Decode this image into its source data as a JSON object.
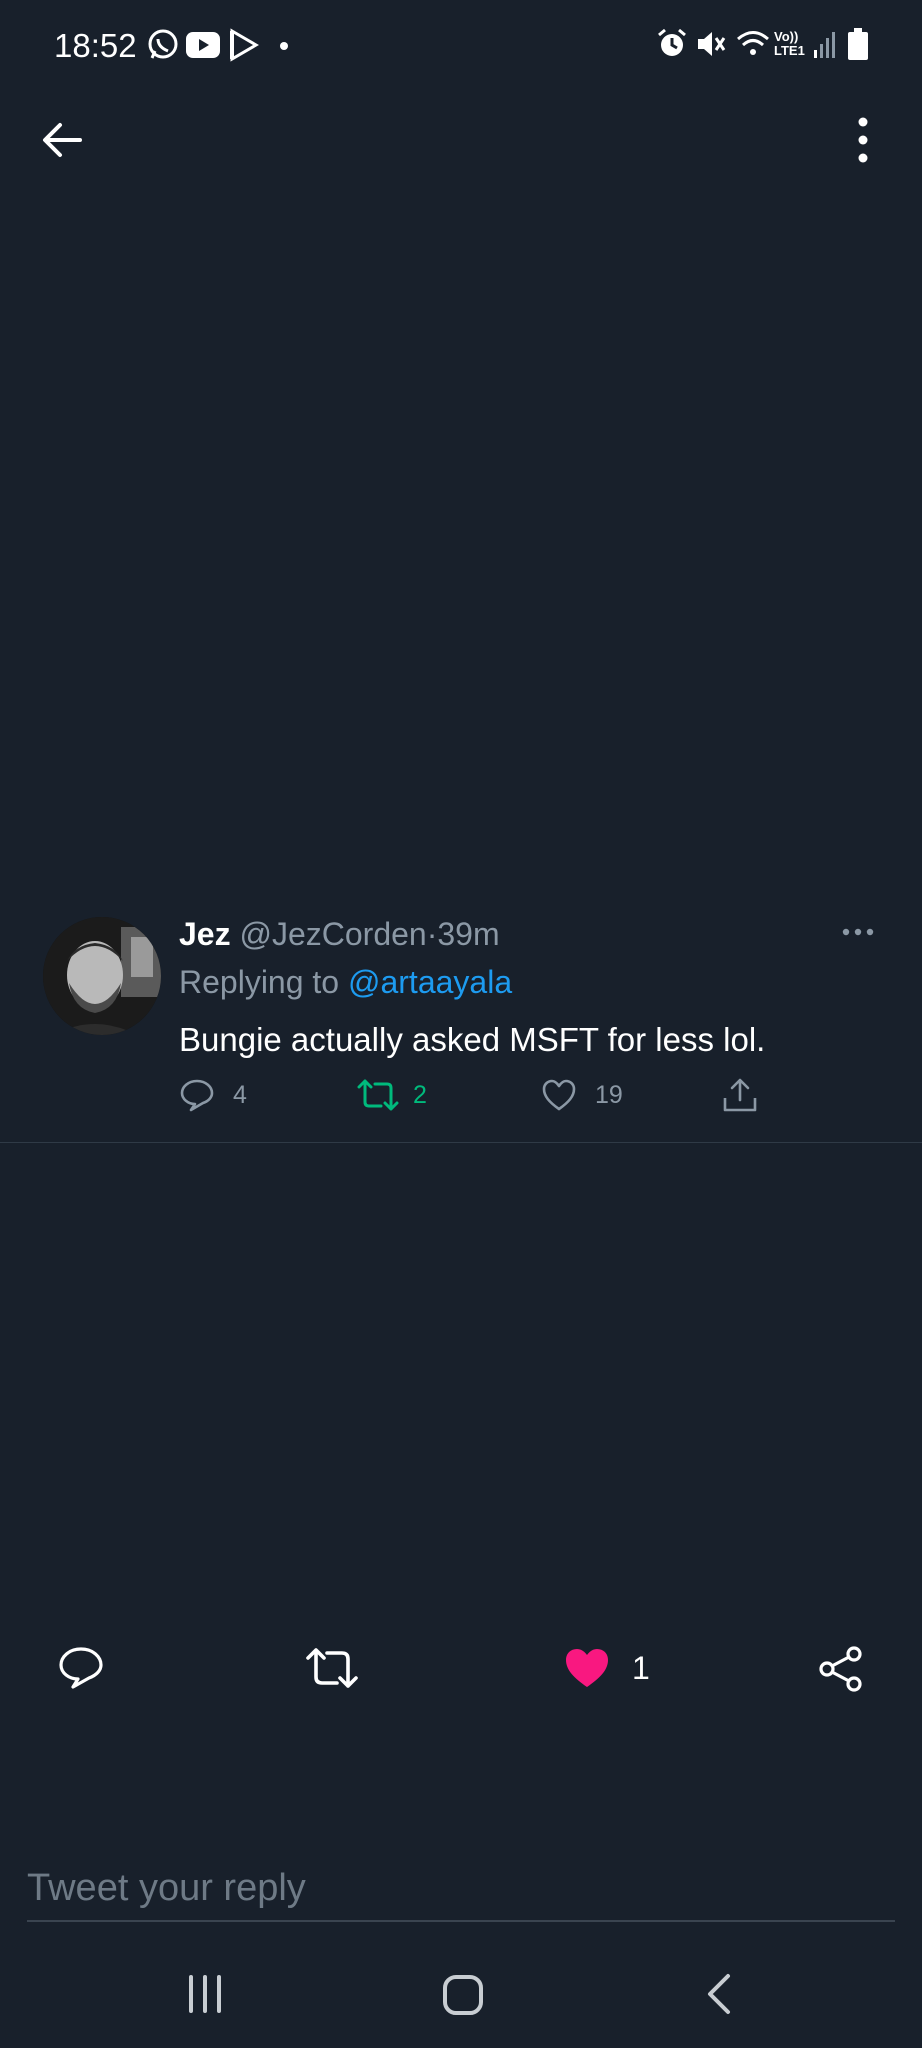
{
  "status_bar": {
    "time": "18:52",
    "network_label_top": "Vo))",
    "network_label_bottom": "LTE1"
  },
  "top_bar": {
    "back_icon": "arrow-left-icon",
    "menu_icon": "more-vertical-icon"
  },
  "tweet": {
    "author_name": "Jez",
    "author_handle": "@JezCorden",
    "separator": "·",
    "time_ago": "39m",
    "replying_prefix": "Replying to",
    "replying_handle": "@artaayala",
    "text": "Bungie actually asked MSFT for less lol.",
    "replies": "4",
    "retweets": "2",
    "likes": "19"
  },
  "action_bar": {
    "like_count": "1",
    "liked": true
  },
  "reply_box": {
    "placeholder": "Tweet your reply"
  },
  "colors": {
    "background": "#18202b",
    "link": "#1d9bf0",
    "retweet_green": "#00ba7c",
    "like_pink": "#f91880",
    "muted": "#8b98a5"
  }
}
